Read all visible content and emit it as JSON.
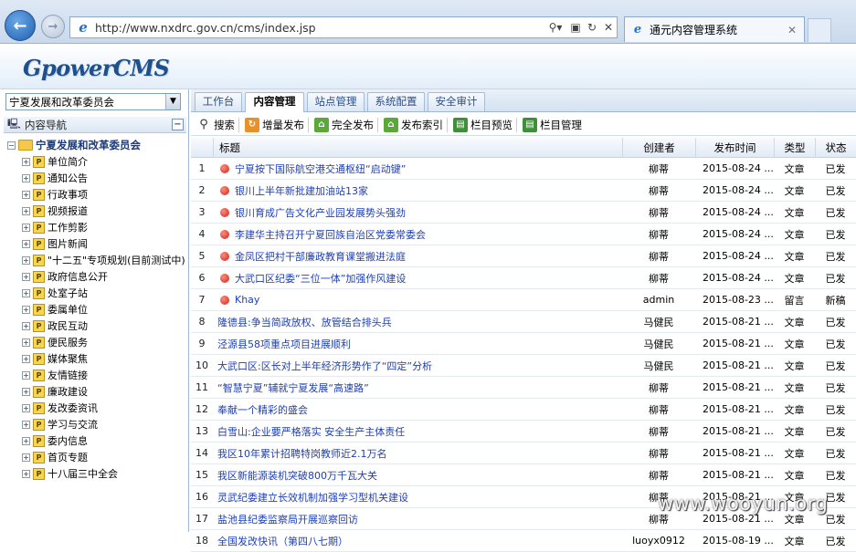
{
  "browser": {
    "url": "http://www.nxdrc.gov.cn/cms/index.jsp",
    "tab_title": "通元内容管理系统",
    "back_glyph": "←",
    "fwd_glyph": "→",
    "ie_glyph": "e",
    "search_glyph": "⚲▾",
    "compat_glyph": "▣",
    "refresh_glyph": "↻",
    "stop_glyph": "✕",
    "tab_close_glyph": "✕"
  },
  "header": {
    "logo": "GpowerCMS"
  },
  "sidebar": {
    "site_select": "宁夏发展和改革委员会",
    "nav_title": "内容导航",
    "collapse_glyph": "−",
    "root": "宁夏发展和改革委员会",
    "items": [
      "单位简介",
      "通知公告",
      "行政事项",
      "视频报道",
      "工作剪影",
      "图片新闻",
      "\"十二五\"专项规划(目前测试中)",
      "政府信息公开",
      "处室子站",
      "委属单位",
      "政民互动",
      "便民服务",
      "媒体聚焦",
      "友情链接",
      "廉政建设",
      "发改委资讯",
      "学习与交流",
      "委内信息",
      "首页专题",
      "十八届三中全会"
    ]
  },
  "tabs": [
    "工作台",
    "内容管理",
    "站点管理",
    "系统配置",
    "安全审计"
  ],
  "toolbar": [
    "搜索",
    "增量发布",
    "完全发布",
    "发布索引",
    "栏目预览",
    "栏目管理"
  ],
  "grid": {
    "headers": {
      "title": "标题",
      "creator": "创建者",
      "time": "发布时间",
      "type": "类型",
      "state": "状态"
    },
    "rows": [
      {
        "n": "1",
        "title": "宁夏按下国际航空港交通枢纽“启动键”",
        "creator": "柳蒂",
        "time": "2015-08-24 ...",
        "type": "文章",
        "state": "已发",
        "dot": true
      },
      {
        "n": "2",
        "title": "银川上半年新批建加油站13家",
        "creator": "柳蒂",
        "time": "2015-08-24 ...",
        "type": "文章",
        "state": "已发",
        "dot": true
      },
      {
        "n": "3",
        "title": "银川育成广告文化产业园发展势头强劲",
        "creator": "柳蒂",
        "time": "2015-08-24 ...",
        "type": "文章",
        "state": "已发",
        "dot": true
      },
      {
        "n": "4",
        "title": "李建华主持召开宁夏回族自治区党委常委会",
        "creator": "柳蒂",
        "time": "2015-08-24 ...",
        "type": "文章",
        "state": "已发",
        "dot": true
      },
      {
        "n": "5",
        "title": "金凤区把村干部廉政教育课堂搬进法庭",
        "creator": "柳蒂",
        "time": "2015-08-24 ...",
        "type": "文章",
        "state": "已发",
        "dot": true
      },
      {
        "n": "6",
        "title": "大武口区纪委“三位一体”加强作风建设",
        "creator": "柳蒂",
        "time": "2015-08-24 ...",
        "type": "文章",
        "state": "已发",
        "dot": true
      },
      {
        "n": "7",
        "title": "Khay",
        "creator": "admin",
        "time": "2015-08-23 ...",
        "type": "留言",
        "state": "新稿",
        "dot": true
      },
      {
        "n": "8",
        "title": "隆德县:争当简政放权、放管结合排头兵",
        "creator": "马健民",
        "time": "2015-08-21 ...",
        "type": "文章",
        "state": "已发",
        "dot": false
      },
      {
        "n": "9",
        "title": "泾源县58项重点项目进展顺利",
        "creator": "马健民",
        "time": "2015-08-21 ...",
        "type": "文章",
        "state": "已发",
        "dot": false
      },
      {
        "n": "10",
        "title": "大武口区:区长对上半年经济形势作了“四定”分析",
        "creator": "马健民",
        "time": "2015-08-21 ...",
        "type": "文章",
        "state": "已发",
        "dot": false
      },
      {
        "n": "11",
        "title": "“智慧宁夏”辅就宁夏发展“高速路”",
        "creator": "柳蒂",
        "time": "2015-08-21 ...",
        "type": "文章",
        "state": "已发",
        "dot": false
      },
      {
        "n": "12",
        "title": "奉献一个精彩的盛会",
        "creator": "柳蒂",
        "time": "2015-08-21 ...",
        "type": "文章",
        "state": "已发",
        "dot": false
      },
      {
        "n": "13",
        "title": "白雪山:企业要严格落实 安全生产主体责任",
        "creator": "柳蒂",
        "time": "2015-08-21 ...",
        "type": "文章",
        "state": "已发",
        "dot": false
      },
      {
        "n": "14",
        "title": "我区10年累计招聘特岗教师近2.1万名",
        "creator": "柳蒂",
        "time": "2015-08-21 ...",
        "type": "文章",
        "state": "已发",
        "dot": false
      },
      {
        "n": "15",
        "title": "我区新能源装机突破800万千瓦大关",
        "creator": "柳蒂",
        "time": "2015-08-21 ...",
        "type": "文章",
        "state": "已发",
        "dot": false
      },
      {
        "n": "16",
        "title": "灵武纪委建立长效机制加强学习型机关建设",
        "creator": "柳蒂",
        "time": "2015-08-21 ...",
        "type": "文章",
        "state": "已发",
        "dot": false
      },
      {
        "n": "17",
        "title": "盐池县纪委监察局开展巡察回访",
        "creator": "柳蒂",
        "time": "2015-08-21 ...",
        "type": "文章",
        "state": "已发",
        "dot": false
      },
      {
        "n": "18",
        "title": "全国发改快讯（第四八七期）",
        "creator": "luoyx0912",
        "time": "2015-08-19 ...",
        "type": "文章",
        "state": "已发",
        "dot": false
      }
    ]
  },
  "watermark": "www.wooyun.org"
}
